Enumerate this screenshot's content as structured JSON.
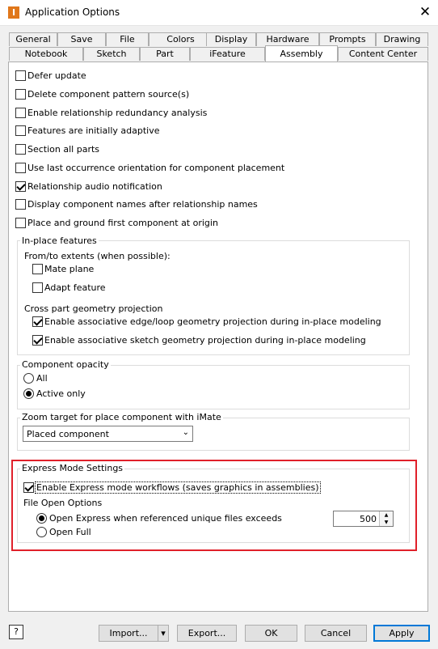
{
  "window": {
    "title": "Application Options",
    "app_icon_glyph": "I",
    "close_glyph": "✕"
  },
  "tabs_row1": [
    "General",
    "Save",
    "File",
    "Colors",
    "Display",
    "Hardware",
    "Prompts",
    "Drawing"
  ],
  "tabs_row2": [
    "Notebook",
    "Sketch",
    "Part",
    "iFeature",
    "Assembly",
    "Content Center"
  ],
  "active_tab": "Assembly",
  "options": [
    {
      "label": "Defer update",
      "checked": false
    },
    {
      "label": "Delete component pattern source(s)",
      "checked": false
    },
    {
      "label": "Enable relationship redundancy analysis",
      "checked": false
    },
    {
      "label": "Features are initially adaptive",
      "checked": false
    },
    {
      "label": "Section all parts",
      "checked": false
    },
    {
      "label": "Use last occurrence orientation for component placement",
      "checked": false
    },
    {
      "label": "Relationship audio notification",
      "checked": true
    },
    {
      "label": "Display component names after relationship names",
      "checked": false
    },
    {
      "label": "Place and ground first component at origin",
      "checked": false
    }
  ],
  "inplace": {
    "title": "In-place features",
    "from_to_label": "From/to extents (when possible):",
    "mate_plane": "Mate plane",
    "adapt_feature": "Adapt feature",
    "cross_part_label": "Cross part geometry projection",
    "edge_loop": "Enable associative edge/loop geometry projection during in-place modeling",
    "sketch_geom": "Enable associative sketch geometry projection during in-place modeling"
  },
  "opacity": {
    "title": "Component opacity",
    "all": "All",
    "active_only": "Active only"
  },
  "zoom": {
    "title": "Zoom target for place component with iMate",
    "selected": "Placed component",
    "arrow_glyph": "⌄"
  },
  "express": {
    "title": "Express Mode Settings",
    "enable": "Enable Express mode workflows (saves graphics in assemblies)",
    "file_open_label": "File Open Options",
    "open_express": "Open Express when referenced unique files exceeds",
    "open_full": "Open Full",
    "threshold": "500",
    "highlight_color": "#e0202a"
  },
  "buttons": {
    "help": "?",
    "import": "Import...",
    "import_arrow": "▾",
    "export": "Export...",
    "ok": "OK",
    "cancel": "Cancel",
    "apply": "Apply"
  }
}
